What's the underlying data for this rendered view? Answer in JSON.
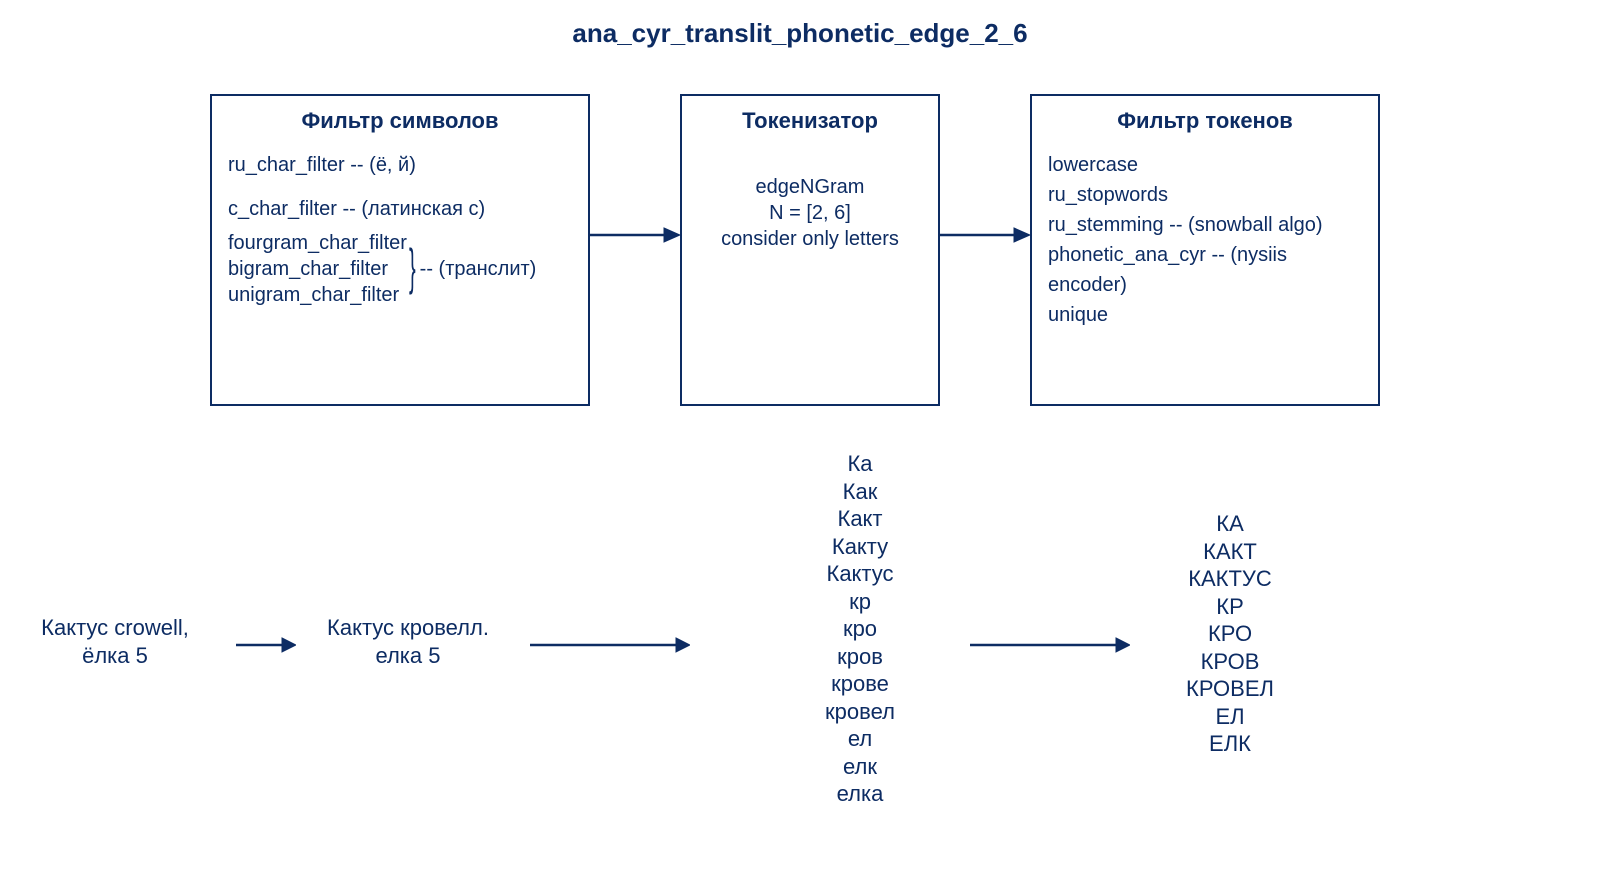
{
  "title": "ana_cyr_translit_phonetic_edge_2_6",
  "boxes": {
    "char_filter": {
      "title": "Фильтр символов",
      "line1": "ru_char_filter -- (ё, й)",
      "line2": "c_char_filter -- (латинская c)",
      "group": {
        "items": [
          "fourgram_char_filter",
          "bigram_char_filter",
          "unigram_char_filter"
        ],
        "label": "-- (транслит)"
      }
    },
    "tokenizer": {
      "title": "Токенизатор",
      "line1": "edgeNGram",
      "line2": "N = [2, 6]",
      "line3": "consider only letters"
    },
    "token_filter": {
      "title": "Фильтр токенов",
      "lines": [
        "lowercase",
        "ru_stopwords",
        "ru_stemming -- (snowball algo)",
        "phonetic_ana_cyr -- (nysiis encoder)",
        "unique"
      ]
    }
  },
  "example": {
    "input": "Кактус crowell,\nёлка 5",
    "after_char_filter": "Кактус кровелл.\nелка 5",
    "after_tokenizer": [
      "Ка",
      "Как",
      "Какт",
      "Какту",
      "Кактус",
      "кр",
      "кро",
      "кров",
      "крове",
      "кровел",
      "ел",
      "елк",
      "елка"
    ],
    "after_token_filter": [
      "КА",
      "КАКТ",
      "КАКТУС",
      "КР",
      "КРО",
      "КРОВ",
      "КРОВЕЛ",
      "ЕЛ",
      "ЕЛК"
    ]
  }
}
